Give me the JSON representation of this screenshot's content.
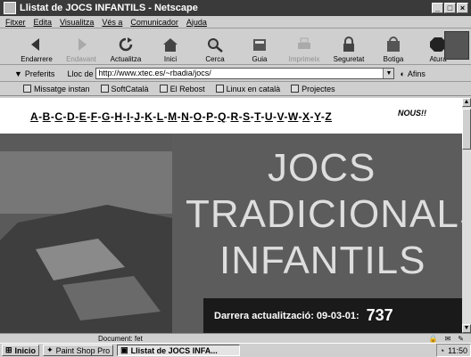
{
  "window": {
    "title": "Llistat de JOCS INFANTILS - Netscape"
  },
  "menu": [
    "Fitxer",
    "Edita",
    "Visualitza",
    "Vés a",
    "Comunicador",
    "Ajuda"
  ],
  "toolbar": [
    {
      "label": "Endarrere",
      "icon": "back-icon",
      "enabled": true
    },
    {
      "label": "Endavant",
      "icon": "forward-icon",
      "enabled": false
    },
    {
      "label": "Actualitza",
      "icon": "reload-icon",
      "enabled": true
    },
    {
      "label": "Inici",
      "icon": "home-icon",
      "enabled": true
    },
    {
      "label": "Cerca",
      "icon": "search-icon",
      "enabled": true
    },
    {
      "label": "Guia",
      "icon": "guide-icon",
      "enabled": true
    },
    {
      "label": "Imprimeix",
      "icon": "print-icon",
      "enabled": false
    },
    {
      "label": "Seguretat",
      "icon": "security-icon",
      "enabled": true
    },
    {
      "label": "Botiga",
      "icon": "shop-icon",
      "enabled": true
    },
    {
      "label": "Atura",
      "icon": "stop-icon",
      "enabled": true
    }
  ],
  "location": {
    "bookmarks_label": "Preferits",
    "label": "Lloc de",
    "url": "http://www.xtec.es/~rbadia/jocs/",
    "related_label": "Afins"
  },
  "links": [
    "Missatge instan",
    "SoftCatalà",
    "El Rebost",
    "Linux en català",
    "Projectes"
  ],
  "page": {
    "alphabet": [
      "A",
      "B",
      "C",
      "D",
      "E",
      "F",
      "G",
      "H",
      "I",
      "J",
      "K",
      "L",
      "M",
      "N",
      "O",
      "P",
      "Q",
      "R",
      "S",
      "T",
      "U",
      "V",
      "W",
      "X",
      "Y",
      "Z"
    ],
    "nous": "NOUS!!",
    "banner_lines": [
      "JOCS",
      "TRADICIONALS",
      "INFANTILS"
    ],
    "update_label": "Darrera actualització: 09-03-01:",
    "update_number": "737"
  },
  "status": {
    "text": "Document: fet"
  },
  "taskbar": {
    "start": "Inicio",
    "items": [
      "Paint Shop Pro",
      "Llistat de JOCS INFA..."
    ],
    "clock": "11:50"
  }
}
